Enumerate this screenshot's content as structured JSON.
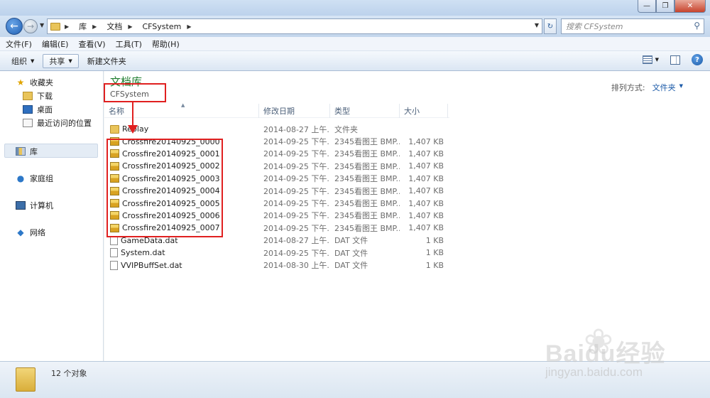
{
  "window": {
    "min": "—",
    "max": "❐",
    "close": "✕"
  },
  "address": {
    "crumbs": [
      "库",
      "文档",
      "CFSystem"
    ],
    "search_placeholder": "搜索 CFSystem"
  },
  "menu": [
    "文件(F)",
    "编辑(E)",
    "查看(V)",
    "工具(T)",
    "帮助(H)"
  ],
  "toolbar": {
    "organize": "组织",
    "share": "共享",
    "new_folder": "新建文件夹"
  },
  "nav": {
    "favorites": "收藏夹",
    "downloads": "下载",
    "desktop": "桌面",
    "recent": "最近访问的位置",
    "libraries": "库",
    "homegroup": "家庭组",
    "computer": "计算机",
    "network": "网络"
  },
  "content": {
    "library_title": "文档库",
    "library_sub": "CFSystem",
    "arrange_label": "排列方式:",
    "arrange_value": "文件夹",
    "columns": [
      "名称",
      "修改日期",
      "类型",
      "大小"
    ],
    "files": [
      {
        "name": "Replay",
        "date": "2014-08-27 上午...",
        "type": "文件夹",
        "size": "",
        "icon": "folder-icon"
      },
      {
        "name": "Crossfire20140925_0000",
        "date": "2014-09-25 下午...",
        "type": "2345看图王 BMP...",
        "size": "1,407 KB",
        "icon": "bmp-image-icon"
      },
      {
        "name": "Crossfire20140925_0001",
        "date": "2014-09-25 下午...",
        "type": "2345看图王 BMP...",
        "size": "1,407 KB",
        "icon": "bmp-image-icon"
      },
      {
        "name": "Crossfire20140925_0002",
        "date": "2014-09-25 下午...",
        "type": "2345看图王 BMP...",
        "size": "1,407 KB",
        "icon": "bmp-image-icon"
      },
      {
        "name": "Crossfire20140925_0003",
        "date": "2014-09-25 下午...",
        "type": "2345看图王 BMP...",
        "size": "1,407 KB",
        "icon": "bmp-image-icon"
      },
      {
        "name": "Crossfire20140925_0004",
        "date": "2014-09-25 下午...",
        "type": "2345看图王 BMP...",
        "size": "1,407 KB",
        "icon": "bmp-image-icon"
      },
      {
        "name": "Crossfire20140925_0005",
        "date": "2014-09-25 下午...",
        "type": "2345看图王 BMP...",
        "size": "1,407 KB",
        "icon": "bmp-image-icon"
      },
      {
        "name": "Crossfire20140925_0006",
        "date": "2014-09-25 下午...",
        "type": "2345看图王 BMP...",
        "size": "1,407 KB",
        "icon": "bmp-image-icon"
      },
      {
        "name": "Crossfire20140925_0007",
        "date": "2014-09-25 下午...",
        "type": "2345看图王 BMP...",
        "size": "1,407 KB",
        "icon": "bmp-image-icon"
      },
      {
        "name": "GameData.dat",
        "date": "2014-08-27 上午...",
        "type": "DAT 文件",
        "size": "1 KB",
        "icon": "dat-file-icon"
      },
      {
        "name": "System.dat",
        "date": "2014-09-25 下午...",
        "type": "DAT 文件",
        "size": "1 KB",
        "icon": "dat-file-icon"
      },
      {
        "name": "VVIPBuffSet.dat",
        "date": "2014-08-30 上午...",
        "type": "DAT 文件",
        "size": "1 KB",
        "icon": "dat-file-icon"
      }
    ]
  },
  "status": {
    "count": "12 个对象"
  },
  "watermark": {
    "logo": "Baidu经验",
    "url": "jingyan.baidu.com"
  }
}
